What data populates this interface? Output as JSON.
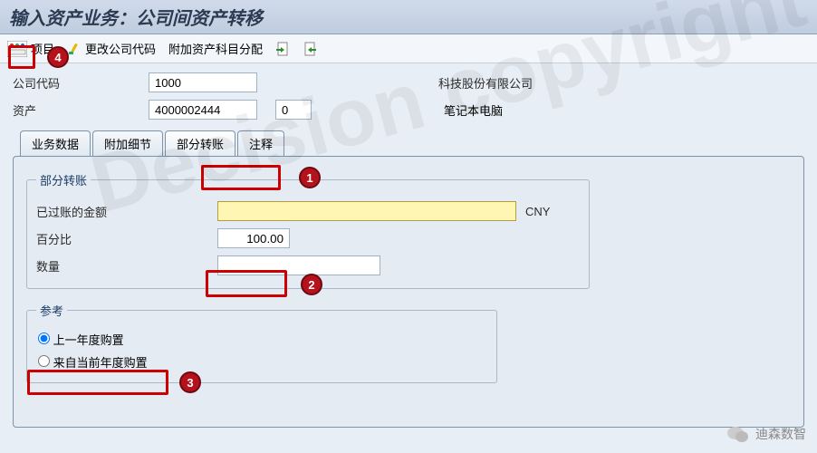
{
  "title": "输入资产业务：公司间资产转移",
  "toolbar": {
    "multi_icon_label": "项目",
    "change_company_label": "更改公司代码",
    "asset_account_label": "附加资产科目分配"
  },
  "header": {
    "company_code_label": "公司代码",
    "company_code_value": "1000",
    "company_name": "科技股份有限公司",
    "asset_label": "资产",
    "asset_value": "4000002444",
    "subnumber_value": "0",
    "asset_desc": "笔记本电脑"
  },
  "tabs": [
    "业务数据",
    "附加细节",
    "部分转账",
    "注释"
  ],
  "active_tab_index": 2,
  "partial": {
    "group_title": "部分转账",
    "posted_amount_label": "已过账的金额",
    "posted_amount_value": "",
    "currency": "CNY",
    "percent_label": "百分比",
    "percent_value": "100.00",
    "qty_label": "数量",
    "qty_value": ""
  },
  "reference": {
    "group_title": "参考",
    "opt_prev_year": "上一年度购置",
    "opt_current_year": "来自当前年度购置",
    "selected": "prev"
  },
  "callouts": [
    "1",
    "2",
    "3",
    "4"
  ],
  "watermark": "Decision copyright",
  "brand": "迪森数智"
}
